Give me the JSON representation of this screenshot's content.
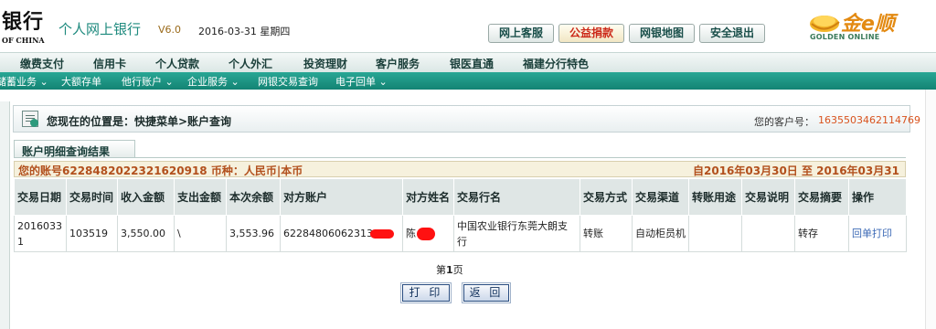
{
  "header": {
    "bank_logo": "银行",
    "bank_sub": "OF CHINA",
    "app_title": "个人网上银行",
    "version": "V6.0",
    "date": "2016-03-31 星期四",
    "buttons": [
      "网上客服",
      "公益捐款",
      "网银地图",
      "安全退出"
    ],
    "brand_name": "金e顺",
    "brand_en": "GOLDEN ONLINE"
  },
  "nav_primary": [
    "缴费支付",
    "信用卡",
    "个人贷款",
    "个人外汇",
    "投资理财",
    "客户服务",
    "银医直通",
    "福建分行特色"
  ],
  "nav_secondary": [
    "储蓄业务 ⌄",
    "大额存单",
    "他行账户 ⌄",
    "企业服务 ⌄",
    "网银交易查询",
    "电子回单 ⌄"
  ],
  "breadcrumb": {
    "text": "您现在的位置是：快捷菜单>账户查询",
    "customer_label": "您的客户号：",
    "customer_no": "1635503462114769"
  },
  "result": {
    "tab_label": "账户明细查询结果",
    "account_info": "您的账号6228482022321620918 币种：人民币|本币",
    "date_range": "自2016年03月30日  至  2016年03月31日"
  },
  "table": {
    "headers": [
      "交易日期",
      "交易时间",
      "收入金额",
      "支出金额",
      "本次余额",
      "对方账户",
      "对方姓名",
      "交易行名",
      "交易方式",
      "交易渠道",
      "转账用途",
      "交易说明",
      "交易摘要",
      "操作"
    ],
    "row": {
      "date": "20160331",
      "time": "103519",
      "income": "3,550.00",
      "expense": "\\",
      "balance": "3,553.96",
      "counter_account": "62284806062313",
      "counter_name": "陈",
      "bank_name": "中国农业银行东莞大朗支行",
      "method": "转账",
      "channel": "自动柜员机",
      "purpose": "",
      "note": "",
      "summary": "转存",
      "action": "回单打印"
    }
  },
  "pager": {
    "prefix": "第",
    "page": "1",
    "suffix": "页"
  },
  "actions": {
    "print": "打 印",
    "back": "返 回"
  },
  "colors": {
    "teal": "#1e8a7e",
    "nav_green": "#1d9684",
    "accent_orange": "#d9531e",
    "link_blue": "#3c6ab6"
  }
}
